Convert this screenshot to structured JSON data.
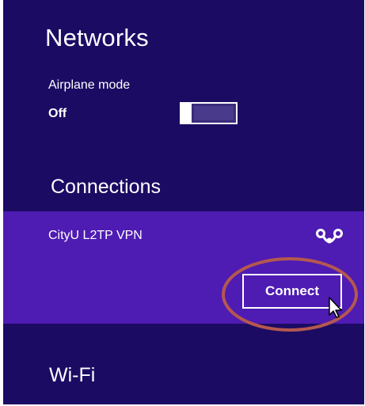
{
  "panel": {
    "title": "Networks",
    "airplane_mode": {
      "label": "Airplane mode",
      "state": "Off",
      "toggle_on": false
    },
    "connections": {
      "heading": "Connections",
      "items": [
        {
          "name": "CityU L2TP VPN",
          "icon": "vpn-icon",
          "action_label": "Connect",
          "selected": true
        }
      ]
    },
    "wifi": {
      "heading": "Wi-Fi"
    }
  },
  "colors": {
    "panel_background": "#1c0b63",
    "selected_row": "#4e1bb3",
    "text": "#ffffff",
    "annotation_ring": "#b4584f"
  }
}
